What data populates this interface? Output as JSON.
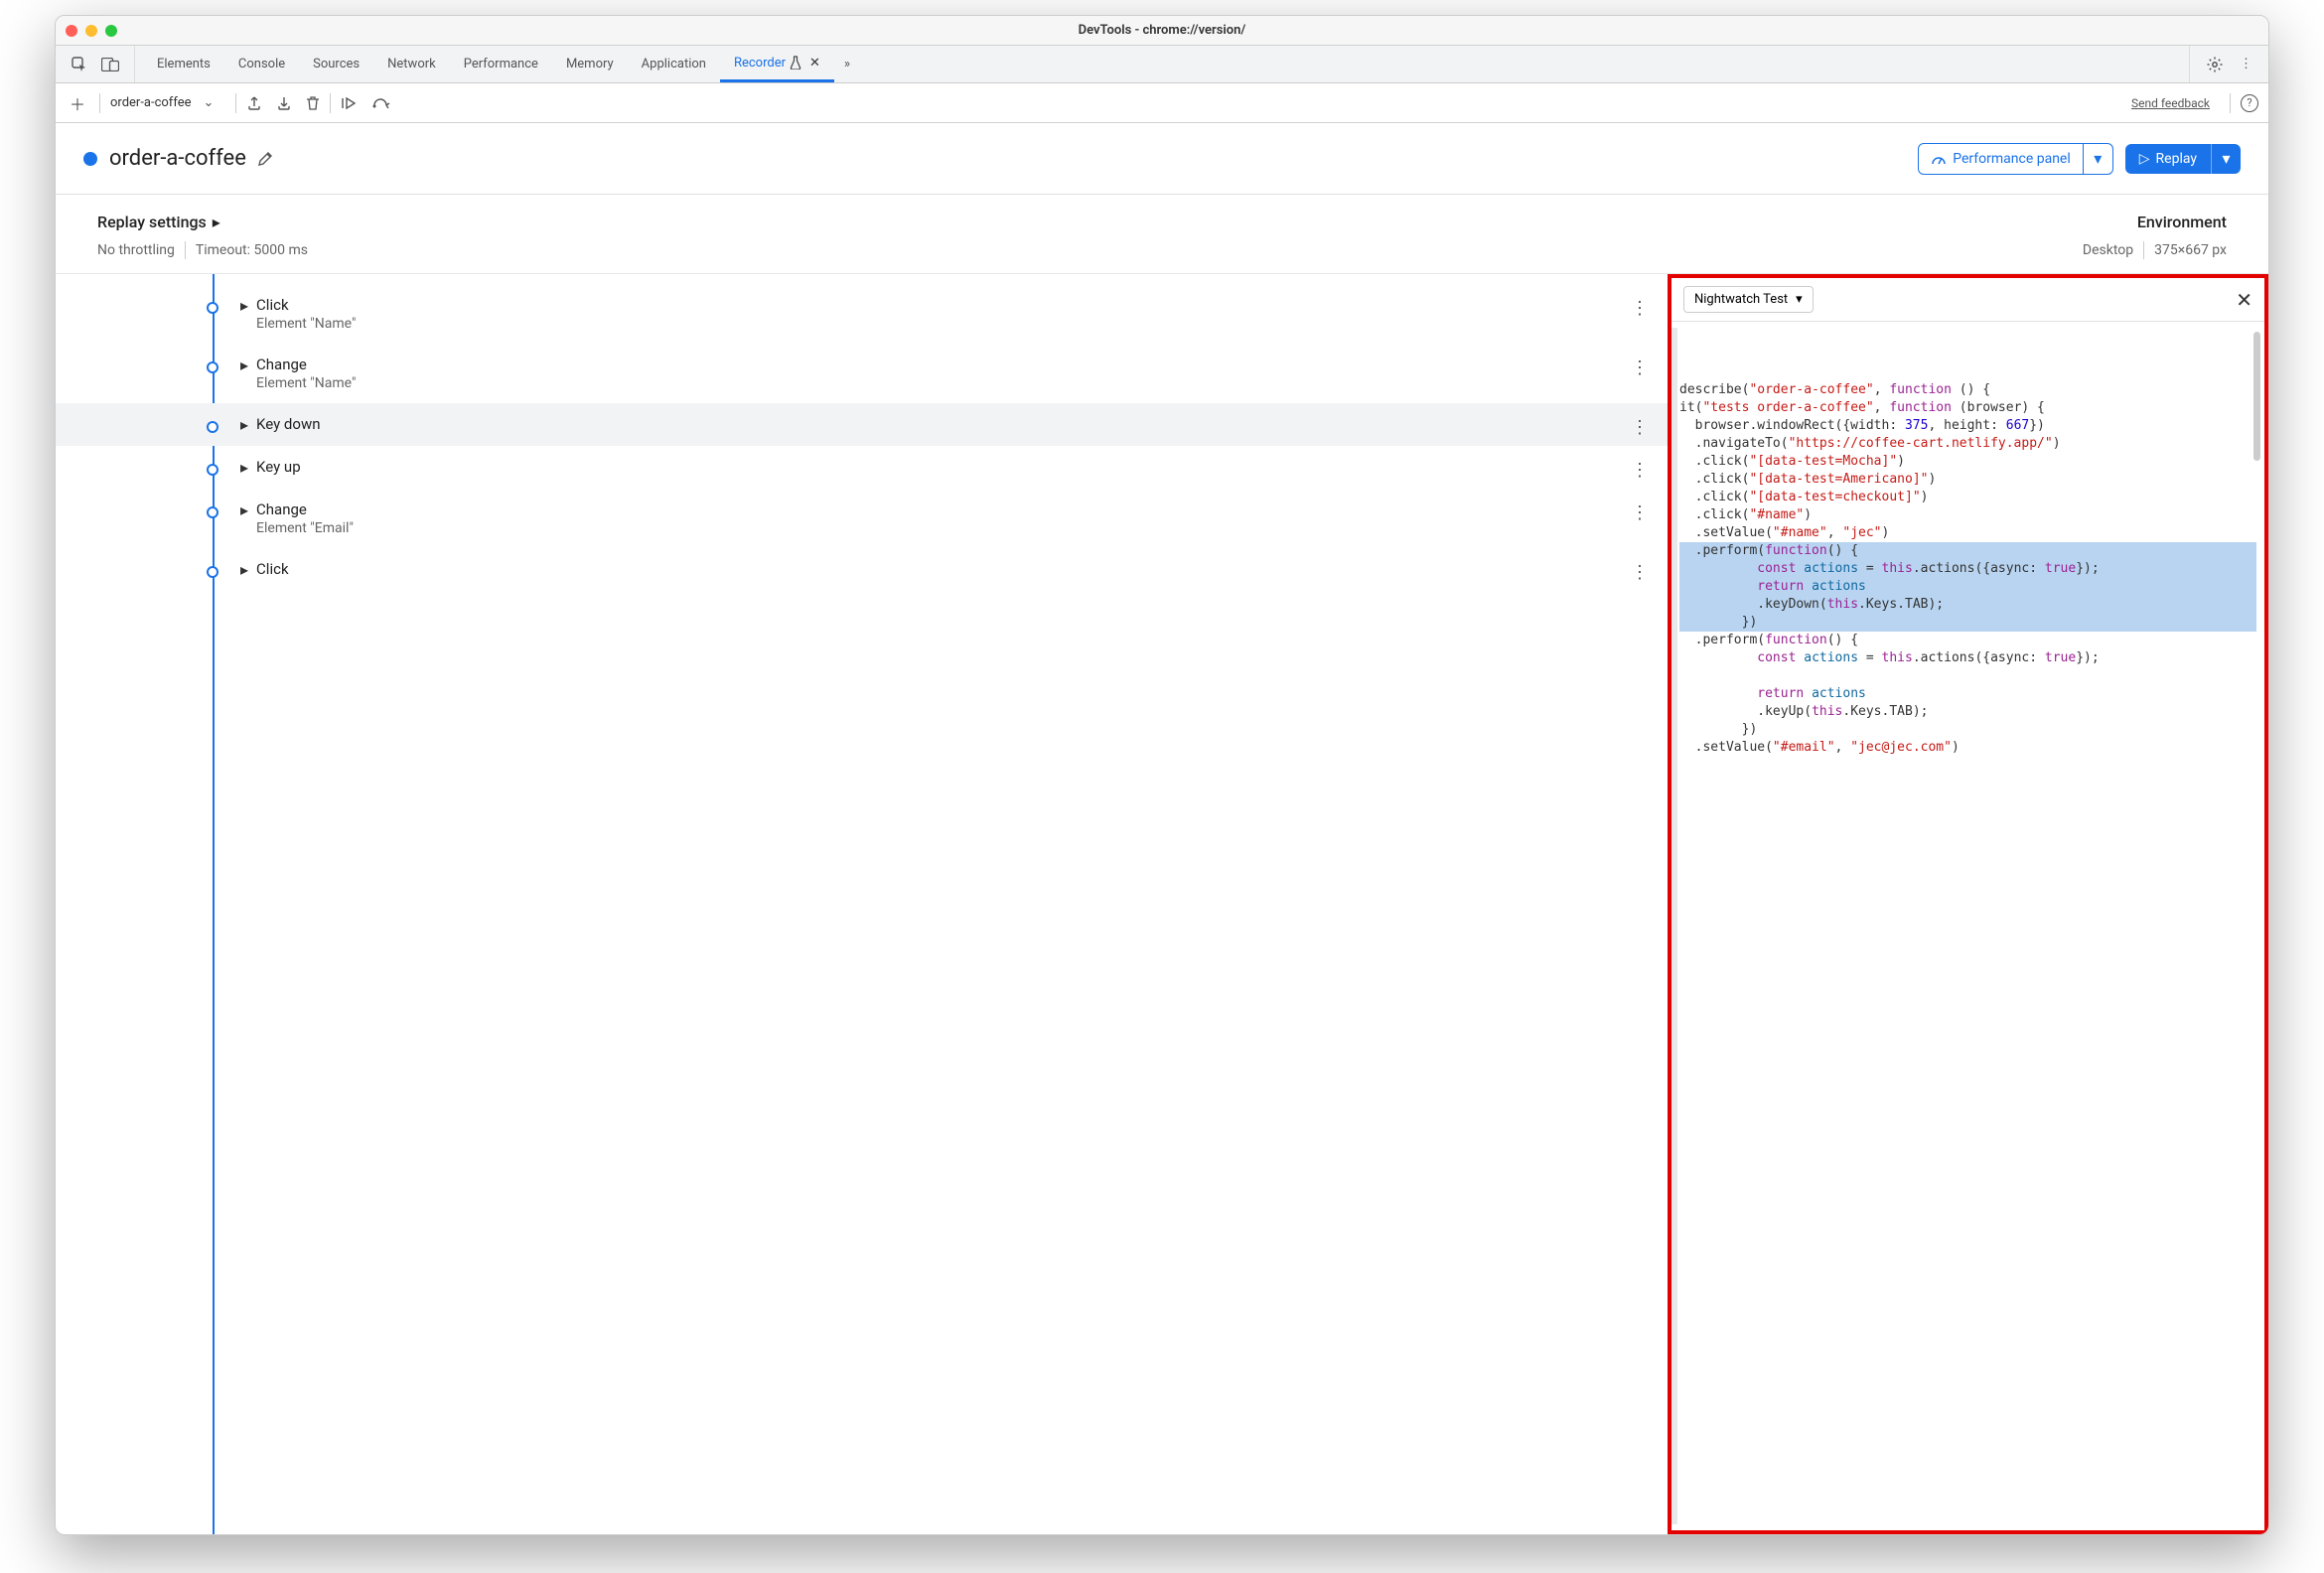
{
  "window_title": "DevTools - chrome://version/",
  "tabs": [
    "Elements",
    "Console",
    "Sources",
    "Network",
    "Performance",
    "Memory",
    "Application",
    "Recorder"
  ],
  "active_tab": "Recorder",
  "toolbar": {
    "recording_name": "order-a-coffee",
    "feedback_label": "Send feedback"
  },
  "header": {
    "title": "order-a-coffee",
    "perf_button": "Performance panel",
    "replay_button": "Replay"
  },
  "settings": {
    "replay_label": "Replay settings",
    "throttling": "No throttling",
    "timeout": "Timeout: 5000 ms",
    "env_label": "Environment",
    "device": "Desktop",
    "viewport": "375×667 px"
  },
  "steps": [
    {
      "title": "Click",
      "subtitle": "Element \"Name\""
    },
    {
      "title": "Change",
      "subtitle": "Element \"Name\""
    },
    {
      "title": "Key down",
      "subtitle": ""
    },
    {
      "title": "Key up",
      "subtitle": ""
    },
    {
      "title": "Change",
      "subtitle": "Element \"Email\""
    },
    {
      "title": "Click",
      "subtitle": ""
    }
  ],
  "export_panel": {
    "dropdown_label": "Nightwatch Test"
  },
  "code": {
    "l1_a": "describe(",
    "l1_b": "\"order-a-coffee\"",
    "l1_c": ", ",
    "l1_d": "function",
    "l1_e": " () {",
    "l2_a": "it(",
    "l2_b": "\"tests order-a-coffee\"",
    "l2_c": ", ",
    "l2_d": "function",
    "l2_e": " (browser) {",
    "l3_a": "  browser.windowRect({width: ",
    "l3_b": "375",
    "l3_c": ", height: ",
    "l3_d": "667",
    "l3_e": "})",
    "l4_a": "  .navigateTo(",
    "l4_b": "\"https://coffee-cart.netlify.app/\"",
    "l4_c": ")",
    "l5_a": "  .click(",
    "l5_b": "\"[data-test=Mocha]\"",
    "l5_c": ")",
    "l6_a": "  .click(",
    "l6_b": "\"[data-test=Americano]\"",
    "l6_c": ")",
    "l7_a": "  .click(",
    "l7_b": "\"[data-test=checkout]\"",
    "l7_c": ")",
    "l8_a": "  .click(",
    "l8_b": "\"#name\"",
    "l8_c": ")",
    "l9_a": "  .setValue(",
    "l9_b": "\"#name\"",
    "l9_c": ", ",
    "l9_d": "\"jec\"",
    "l9_e": ")",
    "l10_a": "  .perform(",
    "l10_b": "function",
    "l10_c": "() {",
    "l11_a": "          ",
    "l11_b": "const",
    "l11_c": " ",
    "l11_d": "actions",
    "l11_e": " = ",
    "l11_f": "this",
    "l11_g": ".actions({async: ",
    "l11_h": "true",
    "l11_i": "});",
    "l12": "",
    "l13_a": "          ",
    "l13_b": "return",
    "l13_c": " ",
    "l13_d": "actions",
    "l14_a": "          .keyDown(",
    "l14_b": "this",
    "l14_c": ".Keys.TAB);",
    "l15": "        })",
    "l16_a": "  .perform(",
    "l16_b": "function",
    "l16_c": "() {",
    "l17_a": "          ",
    "l17_b": "const",
    "l17_c": " ",
    "l17_d": "actions",
    "l17_e": " = ",
    "l17_f": "this",
    "l17_g": ".actions({async: ",
    "l17_h": "true",
    "l17_i": "});",
    "l18": "",
    "l19_a": "          ",
    "l19_b": "return",
    "l19_c": " ",
    "l19_d": "actions",
    "l20_a": "          .keyUp(",
    "l20_b": "this",
    "l20_c": ".Keys.TAB);",
    "l21": "        })",
    "l22_a": "  .setValue(",
    "l22_b": "\"#email\"",
    "l22_c": ", ",
    "l22_d": "\"jec@jec.com\"",
    "l22_e": ")"
  }
}
